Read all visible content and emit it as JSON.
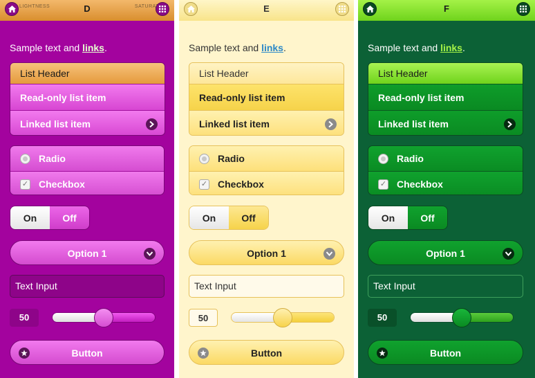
{
  "panels": [
    {
      "theme_letter": "D",
      "header_left_caption": "LIGHTNESS",
      "header_right_caption": "SATURATION",
      "sample_text": "Sample text and ",
      "link_text": "links",
      "sample_end": ".",
      "list_header": "List Header",
      "readonly_item": "Read-only list item",
      "linked_item": "Linked list item",
      "radio_label": "Radio",
      "checkbox_label": "Checkbox",
      "flip_on": "On",
      "flip_off": "Off",
      "select_value": "Option 1",
      "text_input_placeholder": "Text Input",
      "slider_value": "50",
      "slider_level_percent": 50,
      "button_label": "Button",
      "colors": {
        "background": "#a3039e",
        "header": "#e59a3c",
        "accent": "#d746d2"
      }
    },
    {
      "theme_letter": "E",
      "header_left_caption": "",
      "header_right_caption": "",
      "sample_text": "Sample text and ",
      "link_text": "links",
      "sample_end": ".",
      "list_header": "List Header",
      "readonly_item": "Read-only list item",
      "linked_item": "Linked list item",
      "radio_label": "Radio",
      "checkbox_label": "Checkbox",
      "flip_on": "On",
      "flip_off": "Off",
      "select_value": "Option 1",
      "text_input_placeholder": "Text Input",
      "slider_value": "50",
      "slider_level_percent": 50,
      "button_label": "Button",
      "colors": {
        "background": "#fff5cc",
        "header": "#f8e48a",
        "accent": "#f6d34a"
      }
    },
    {
      "theme_letter": "F",
      "header_left_caption": "",
      "header_right_caption": "",
      "sample_text": "Sample text and ",
      "link_text": "links",
      "sample_end": ".",
      "list_header": "List Header",
      "readonly_item": "Read-only list item",
      "linked_item": "Linked list item",
      "radio_label": "Radio",
      "checkbox_label": "Checkbox",
      "flip_on": "On",
      "flip_off": "Off",
      "select_value": "Option 1",
      "text_input_placeholder": "Text Input",
      "slider_value": "50",
      "slider_level_percent": 50,
      "button_label": "Button",
      "colors": {
        "background": "#0c6136",
        "header": "#6fd31c",
        "accent": "#0a8a22"
      }
    }
  ],
  "icons": {
    "header_left": "home-icon",
    "header_right": "grid-icon",
    "list_arrow": "chevron-right-icon",
    "select_arrow": "chevron-down-icon",
    "button_icon": "star-icon",
    "checkbox_mark": "✓"
  }
}
